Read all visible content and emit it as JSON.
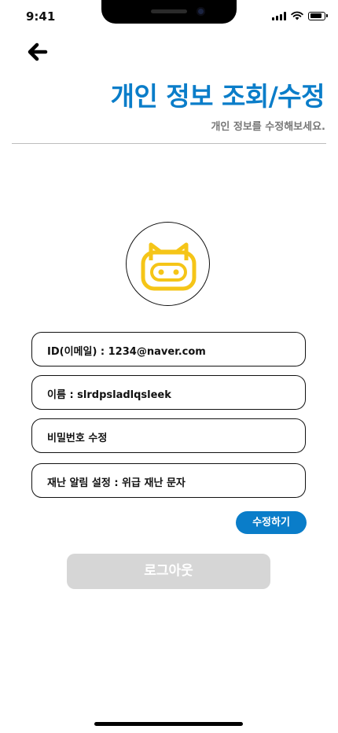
{
  "status_bar": {
    "time": "9:41",
    "icons": [
      "cellular-signal-icon",
      "wifi-icon",
      "battery-icon"
    ]
  },
  "header": {
    "back_icon": "arrow-left-icon",
    "title": "개인 정보 조회/수정",
    "subtitle": "개인 정보를 수정해보세요."
  },
  "profile": {
    "avatar_icon": "robot-face-icon",
    "avatar_color": "#F5C518"
  },
  "fields": [
    {
      "label": "ID(이메일) : 1234@naver.com"
    },
    {
      "label": "이름 : slrdpsladlqsleek"
    },
    {
      "label": "비밀번호 수정"
    },
    {
      "label": "재난 알림 설정 : 위급 재난 문자"
    }
  ],
  "actions": {
    "edit_label": "수정하기",
    "logout_label": "로그아웃"
  },
  "colors": {
    "accent": "#0A7DC9",
    "subtitle": "#777777",
    "logout_disabled": "#D6D6D6"
  }
}
